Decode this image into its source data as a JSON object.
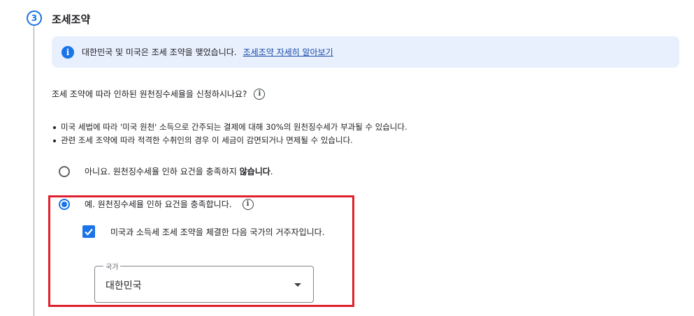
{
  "step": {
    "number": "3",
    "title": "조세조약"
  },
  "banner": {
    "icon": "info-icon",
    "text": "대한민국 및 미국은 조세 조약을 맺었습니다.",
    "link": "조세조약 자세히 알아보기"
  },
  "question": {
    "text": "조세 조약에 따라 인하된 원천징수세율을 신청하시나요?",
    "icon": "info-outline-icon"
  },
  "bullets": [
    "미국 세법에 따라 '미국 원천' 소득으로 간주되는 결제에 대해 30%의 원천징수세가 부과될 수 있습니다.",
    "관련 조세 조약에 따라 적격한 수취인의 경우 이 세금이 감면되거나 면제될 수 있습니다."
  ],
  "options": {
    "no": {
      "text": "아니요. 원천징수세율 인하 요건을 충족하지 ",
      "bold": "않습니다",
      "suffix": ".",
      "selected": false
    },
    "yes": {
      "text": "예. 원천징수세율 인하 요건을 충족합니다.",
      "selected": true
    }
  },
  "residency_checkbox": {
    "label": "미국과 소득세 조세 조약을 체결한 다음 국가의 거주자입니다.",
    "checked": true
  },
  "country_field": {
    "label": "국가",
    "value": "대한민국"
  },
  "colors": {
    "accent": "#1a73e8",
    "banner_bg": "#e8f0fe",
    "highlight": "#e0202e",
    "link": "#1a4ba8"
  }
}
